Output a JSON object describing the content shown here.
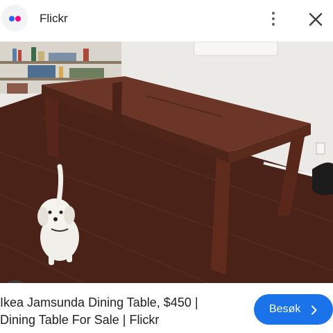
{
  "header": {
    "site_name": "Flickr",
    "logo_colors": [
      "#2962ff",
      "#ff0084"
    ],
    "more_icon": "more-vert-icon",
    "close_icon": "close-icon"
  },
  "image": {
    "description_icon": "google-lens-icon"
  },
  "result": {
    "title_line1": "Ikea Jamsunda Dining Table, $450 |",
    "title_line2": "Dining Table For Sale | Flickr",
    "visit_label": "Besøk",
    "visit_icon": "chevron-right-icon",
    "accent_color": "#1a73e8"
  }
}
